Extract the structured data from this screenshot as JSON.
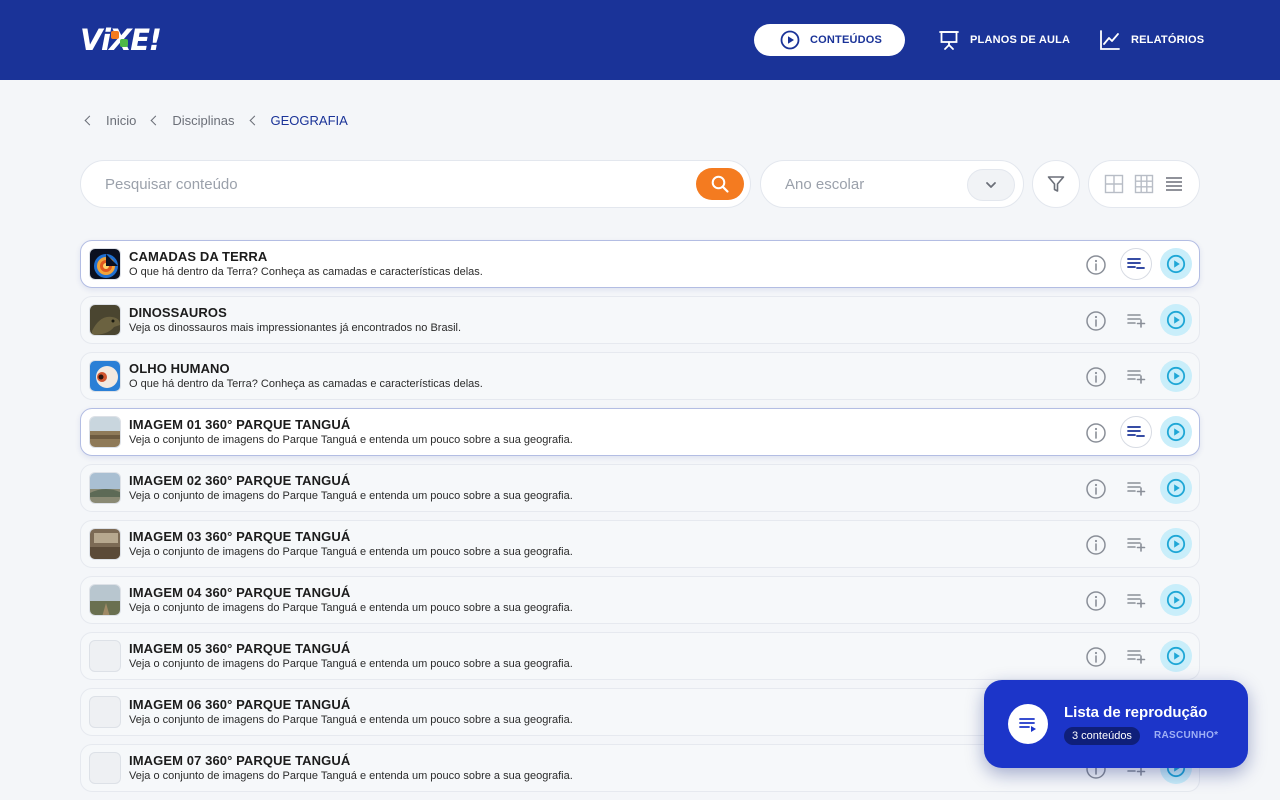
{
  "app": {
    "logo_text": "ViXE!"
  },
  "header": {
    "nav": [
      {
        "label": "CONTEÚDOS",
        "icon": "play-circle-icon",
        "active": true
      },
      {
        "label": "PLANOS DE AULA",
        "icon": "presentation-board-icon",
        "active": false
      },
      {
        "label": "RELATÓRIOS",
        "icon": "line-chart-icon",
        "active": false
      }
    ]
  },
  "breadcrumb": [
    "Inicio",
    "Disciplinas",
    "GEOGRAFIA"
  ],
  "search": {
    "placeholder": "Pesquisar conteúdo",
    "icon": "search-icon"
  },
  "filters": {
    "ano_placeholder": "Ano escolar",
    "icons": [
      "chevron-down-icon",
      "filter-icon"
    ]
  },
  "view_modes": [
    "grid-large-icon",
    "grid-small-icon",
    "list-icon"
  ],
  "colors": {
    "header": "#1a3398",
    "accent_orange": "#f47b20",
    "play_bg": "#c9eefa",
    "play_fg": "#1fa7d6",
    "playlist_card": "#1c35c9"
  },
  "items": [
    {
      "title": "CAMADAS DA TERRA",
      "description": "O que há dentro da Terra? Conheça as camadas e características delas.",
      "in_playlist": true,
      "thumb": "earth-layers"
    },
    {
      "title": "DINOSSAUROS",
      "description": "Veja os dinossauros mais impressionantes já encontrados no Brasil.",
      "in_playlist": false,
      "thumb": "dinosaur"
    },
    {
      "title": "OLHO HUMANO",
      "description": "O que há dentro da Terra? Conheça as camadas e características delas.",
      "in_playlist": false,
      "thumb": "eye"
    },
    {
      "title": "IMAGEM 01 360° PARQUE TANGUÁ",
      "description": "Veja o conjunto de imagens do Parque Tanguá e entenda um pouco sobre a sua geografia.",
      "in_playlist": true,
      "thumb": "park1"
    },
    {
      "title": "IMAGEM 02 360° PARQUE TANGUÁ",
      "description": "Veja o conjunto de imagens do Parque Tanguá e entenda um pouco sobre a sua geografia.",
      "in_playlist": false,
      "thumb": "park2"
    },
    {
      "title": "IMAGEM 03 360° PARQUE TANGUÁ",
      "description": "Veja o conjunto de imagens do Parque Tanguá e entenda um pouco sobre a sua geografia.",
      "in_playlist": false,
      "thumb": "park3"
    },
    {
      "title": "IMAGEM 04 360° PARQUE TANGUÁ",
      "description": "Veja o conjunto de imagens do Parque Tanguá e entenda um pouco sobre a sua geografia.",
      "in_playlist": false,
      "thumb": "park4"
    },
    {
      "title": "IMAGEM 05 360° PARQUE TANGUÁ",
      "description": "Veja o conjunto de imagens do Parque Tanguá e entenda um pouco sobre a sua geografia.",
      "in_playlist": false,
      "thumb": "empty"
    },
    {
      "title": "IMAGEM 06 360° PARQUE TANGUÁ",
      "description": "Veja o conjunto de imagens do Parque Tanguá e entenda um pouco sobre a sua geografia.",
      "in_playlist": false,
      "thumb": "empty"
    },
    {
      "title": "IMAGEM 07 360° PARQUE TANGUÁ",
      "description": "Veja o conjunto de imagens do Parque Tanguá e entenda um pouco sobre a sua geografia.",
      "in_playlist": false,
      "thumb": "empty"
    }
  ],
  "playlist": {
    "title": "Lista de reprodução",
    "count_label": "3 conteúdos",
    "status": "RASCUNHO*",
    "icon": "playlist-icon"
  }
}
